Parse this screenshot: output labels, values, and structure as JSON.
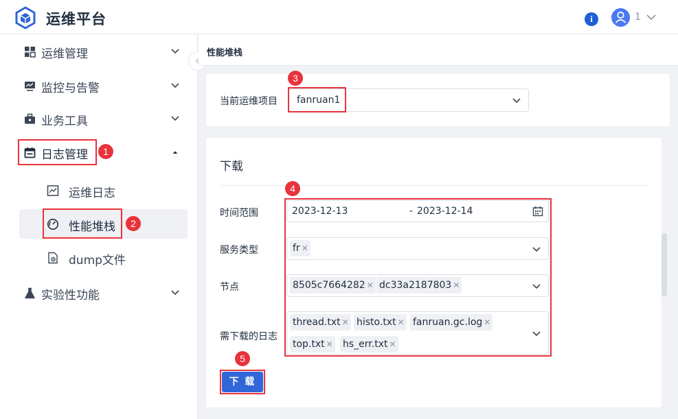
{
  "header": {
    "app_title": "运维平台",
    "logo_icon": "cube-logo-icon",
    "info_icon_glyph": "i",
    "user_name": "1"
  },
  "sidebar": {
    "items": [
      {
        "label": "运维管理",
        "icon": "grid-icon",
        "expanded": false
      },
      {
        "label": "监控与告警",
        "icon": "monitor-icon",
        "expanded": false
      },
      {
        "label": "业务工具",
        "icon": "toolbox-icon",
        "expanded": false
      },
      {
        "label": "日志管理",
        "icon": "calendar-icon",
        "expanded": true
      },
      {
        "label": "实验性功能",
        "icon": "flask-icon",
        "expanded": false
      }
    ],
    "sub_items": [
      {
        "label": "运维日志",
        "icon": "chart-icon",
        "active": false
      },
      {
        "label": "性能堆栈",
        "icon": "gauge-icon",
        "active": true
      },
      {
        "label": "dump文件",
        "icon": "file-gear-icon",
        "active": false
      }
    ]
  },
  "breadcrumb": "性能堆栈",
  "project": {
    "label": "当前运维项目",
    "value": "fanruan1"
  },
  "download_section": {
    "title": "下载",
    "time_range": {
      "label": "时间范围",
      "start": "2023-12-13",
      "separator": "-",
      "end": "2023-12-14"
    },
    "service_type": {
      "label": "服务类型",
      "tags": [
        "fr"
      ]
    },
    "nodes": {
      "label": "节点",
      "tags": [
        "8505c7664282",
        "dc33a2187803"
      ]
    },
    "logs": {
      "label": "需下载的日志",
      "tags": [
        "thread.txt",
        "histo.txt",
        "fanruan.gc.log",
        "top.txt",
        "hs_err.txt"
      ]
    },
    "download_button": "下 载"
  },
  "annotations": [
    "1",
    "2",
    "3",
    "4",
    "5"
  ],
  "colors": {
    "primary": "#2f66d8",
    "annotation_red": "#e8333c",
    "active_bg": "#eef0f4"
  }
}
